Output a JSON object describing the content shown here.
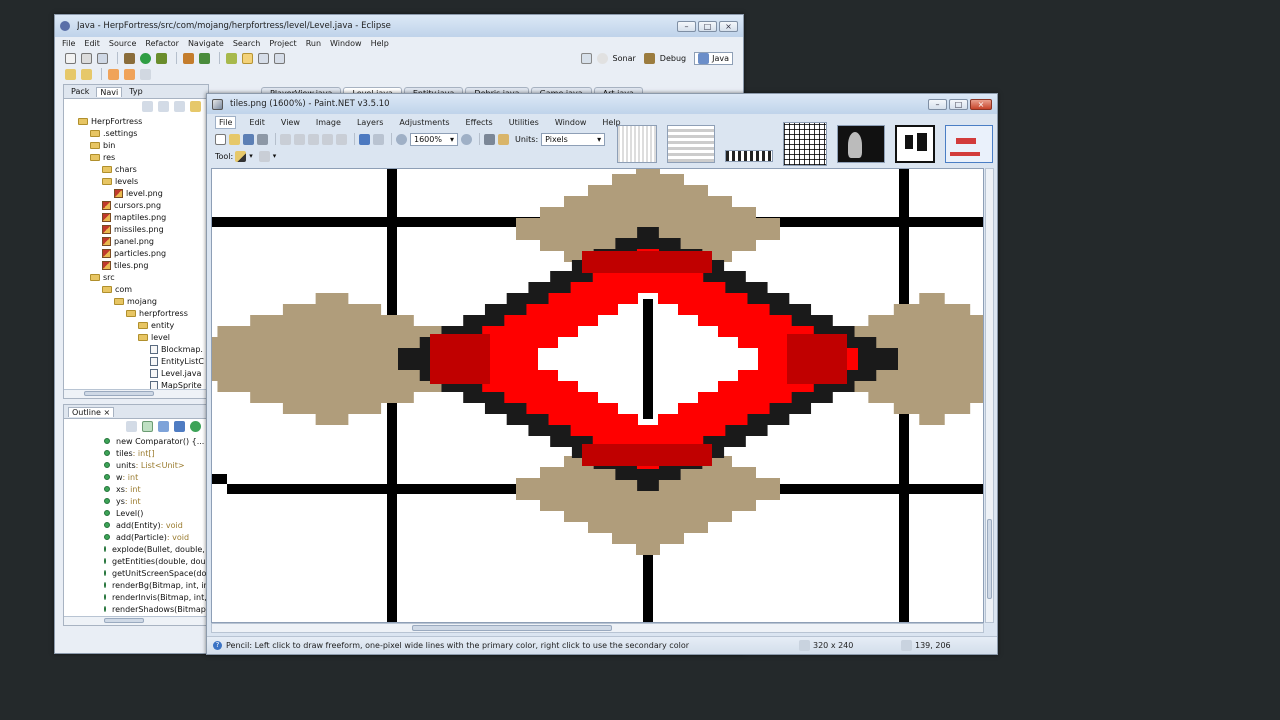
{
  "eclipse": {
    "title": "Java - HerpFortress/src/com/mojang/herpfortress/level/Level.java - Eclipse",
    "menu": [
      "File",
      "Edit",
      "Source",
      "Refactor",
      "Navigate",
      "Search",
      "Project",
      "Run",
      "Window",
      "Help"
    ],
    "perspectives": [
      "Sonar",
      "Debug",
      "Java"
    ],
    "editor_tabs": [
      "PlayerView.java",
      "Level.java",
      "Entity.java",
      "Debris.java",
      "Game.java",
      "Art.java"
    ],
    "nav_tabs": [
      "Pack",
      "Navi",
      "Typ"
    ],
    "tree": [
      {
        "label": "HerpFortress",
        "indent": 0,
        "kind": "project"
      },
      {
        "label": ".settings",
        "indent": 1,
        "kind": "folder"
      },
      {
        "label": "bin",
        "indent": 1,
        "kind": "folder"
      },
      {
        "label": "res",
        "indent": 1,
        "kind": "folder"
      },
      {
        "label": "chars",
        "indent": 2,
        "kind": "folder"
      },
      {
        "label": "levels",
        "indent": 2,
        "kind": "folder"
      },
      {
        "label": "level.png",
        "indent": 3,
        "kind": "image"
      },
      {
        "label": "cursors.png",
        "indent": 2,
        "kind": "image"
      },
      {
        "label": "maptiles.png",
        "indent": 2,
        "kind": "image"
      },
      {
        "label": "missiles.png",
        "indent": 2,
        "kind": "image"
      },
      {
        "label": "panel.png",
        "indent": 2,
        "kind": "image"
      },
      {
        "label": "particles.png",
        "indent": 2,
        "kind": "image"
      },
      {
        "label": "tiles.png",
        "indent": 2,
        "kind": "image"
      },
      {
        "label": "src",
        "indent": 1,
        "kind": "folder"
      },
      {
        "label": "com",
        "indent": 2,
        "kind": "folder"
      },
      {
        "label": "mojang",
        "indent": 3,
        "kind": "folder"
      },
      {
        "label": "herpfortress",
        "indent": 4,
        "kind": "folder"
      },
      {
        "label": "entity",
        "indent": 5,
        "kind": "folder"
      },
      {
        "label": "level",
        "indent": 5,
        "kind": "folder"
      },
      {
        "label": "Blockmap.",
        "indent": 6,
        "kind": "java"
      },
      {
        "label": "EntityListC",
        "indent": 6,
        "kind": "java"
      },
      {
        "label": "Level.java",
        "indent": 6,
        "kind": "java"
      },
      {
        "label": "MapSprite",
        "indent": 6,
        "kind": "java"
      }
    ],
    "outline_tab": "Outline",
    "outline": [
      {
        "label": "new Comparator() {...",
        "type": ""
      },
      {
        "label": "tiles",
        "type": " : int[]"
      },
      {
        "label": "units",
        "type": " : List<Unit>"
      },
      {
        "label": "w",
        "type": " : int"
      },
      {
        "label": "xs",
        "type": " : int"
      },
      {
        "label": "ys",
        "type": " : int"
      },
      {
        "label": "Level()",
        "type": ""
      },
      {
        "label": "add(Entity)",
        "type": " : void"
      },
      {
        "label": "add(Particle)",
        "type": " : void"
      },
      {
        "label": "explode(Bullet, double, do",
        "type": ""
      },
      {
        "label": "getEntities(double, doubl",
        "type": ""
      },
      {
        "label": "getUnitScreenSpace(doub",
        "type": ""
      },
      {
        "label": "renderBg(Bitmap, int, int)",
        "type": ""
      },
      {
        "label": "renderInvis(Bitmap, int, in",
        "type": ""
      },
      {
        "label": "renderShadows(Bitmap)",
        "type": ""
      }
    ]
  },
  "paintnet": {
    "title": "tiles.png (1600%) - Paint.NET v3.5.10",
    "menu": [
      "File",
      "Edit",
      "View",
      "Image",
      "Layers",
      "Adjustments",
      "Effects",
      "Utilities",
      "Window",
      "Help"
    ],
    "zoom": "1600%",
    "units_label": "Units:",
    "units_value": "Pixels",
    "tool_label": "Tool:",
    "status_text": "Pencil: Left click to draw freeform, one-pixel wide lines with the primary color, right click to use the secondary color",
    "image_size": "320 x 240",
    "cursor_pos": "139, 206",
    "colors": {
      "tan": "#b09d7b",
      "black": "#1a1a1a",
      "red": "#ff0000",
      "darkred": "#c00000",
      "white": "#ffffff"
    }
  }
}
